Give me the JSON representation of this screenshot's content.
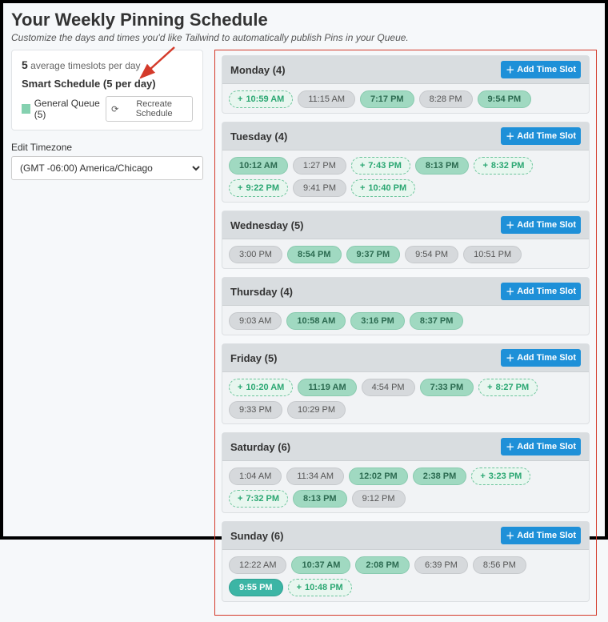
{
  "header": {
    "title": "Your Weekly Pinning Schedule",
    "subtitle": "Customize the days and times you'd like Tailwind to automatically publish Pins in your Queue."
  },
  "sidebar": {
    "avg_count": "5",
    "avg_text": "average timeslots per day",
    "smart": "Smart Schedule (5 per day)",
    "queue_label": "General Queue (5)",
    "recreate": "Recreate Schedule",
    "tz_label": "Edit Timezone",
    "tz_value": "(GMT -06:00) America/Chicago"
  },
  "add_label": "Add Time Slot",
  "days": [
    {
      "name": "Monday",
      "count": "4",
      "slots": [
        {
          "t": "10:59 AM",
          "style": "dashed",
          "plus": true
        },
        {
          "t": "11:15 AM",
          "style": "filled-gray"
        },
        {
          "t": "7:17 PM",
          "style": "filled-green"
        },
        {
          "t": "8:28 PM",
          "style": "filled-gray"
        },
        {
          "t": "9:54 PM",
          "style": "filled-green"
        }
      ]
    },
    {
      "name": "Tuesday",
      "count": "4",
      "slots": [
        {
          "t": "10:12 AM",
          "style": "filled-green"
        },
        {
          "t": "1:27 PM",
          "style": "filled-gray"
        },
        {
          "t": "7:43 PM",
          "style": "dashed",
          "plus": true
        },
        {
          "t": "8:13 PM",
          "style": "filled-green"
        },
        {
          "t": "8:32 PM",
          "style": "dashed",
          "plus": true
        },
        {
          "t": "9:22 PM",
          "style": "dashed",
          "plus": true
        },
        {
          "t": "9:41 PM",
          "style": "filled-gray"
        },
        {
          "t": "10:40 PM",
          "style": "dashed",
          "plus": true
        }
      ]
    },
    {
      "name": "Wednesday",
      "count": "5",
      "slots": [
        {
          "t": "3:00 PM",
          "style": "filled-gray"
        },
        {
          "t": "8:54 PM",
          "style": "filled-green"
        },
        {
          "t": "9:37 PM",
          "style": "filled-green"
        },
        {
          "t": "9:54 PM",
          "style": "filled-gray"
        },
        {
          "t": "10:51 PM",
          "style": "filled-gray"
        }
      ]
    },
    {
      "name": "Thursday",
      "count": "4",
      "slots": [
        {
          "t": "9:03 AM",
          "style": "filled-gray"
        },
        {
          "t": "10:58 AM",
          "style": "filled-green"
        },
        {
          "t": "3:16 PM",
          "style": "filled-green"
        },
        {
          "t": "8:37 PM",
          "style": "filled-green"
        }
      ]
    },
    {
      "name": "Friday",
      "count": "5",
      "slots": [
        {
          "t": "10:20 AM",
          "style": "dashed",
          "plus": true
        },
        {
          "t": "11:19 AM",
          "style": "filled-green"
        },
        {
          "t": "4:54 PM",
          "style": "filled-gray"
        },
        {
          "t": "7:33 PM",
          "style": "filled-green"
        },
        {
          "t": "8:27 PM",
          "style": "dashed",
          "plus": true
        },
        {
          "t": "9:33 PM",
          "style": "filled-gray"
        },
        {
          "t": "10:29 PM",
          "style": "filled-gray"
        }
      ]
    },
    {
      "name": "Saturday",
      "count": "6",
      "slots": [
        {
          "t": "1:04 AM",
          "style": "filled-gray"
        },
        {
          "t": "11:34 AM",
          "style": "filled-gray"
        },
        {
          "t": "12:02 PM",
          "style": "filled-green"
        },
        {
          "t": "2:38 PM",
          "style": "filled-green"
        },
        {
          "t": "3:23 PM",
          "style": "dashed",
          "plus": true
        },
        {
          "t": "7:32 PM",
          "style": "dashed",
          "plus": true
        },
        {
          "t": "8:13 PM",
          "style": "filled-green"
        },
        {
          "t": "9:12 PM",
          "style": "filled-gray"
        }
      ]
    },
    {
      "name": "Sunday",
      "count": "6",
      "slots": [
        {
          "t": "12:22 AM",
          "style": "filled-gray"
        },
        {
          "t": "10:37 AM",
          "style": "filled-green"
        },
        {
          "t": "2:08 PM",
          "style": "filled-green"
        },
        {
          "t": "6:39 PM",
          "style": "filled-gray"
        },
        {
          "t": "8:56 PM",
          "style": "filled-gray"
        },
        {
          "t": "9:55 PM",
          "style": "filled-teal"
        },
        {
          "t": "10:48 PM",
          "style": "dashed",
          "plus": true
        }
      ]
    }
  ]
}
